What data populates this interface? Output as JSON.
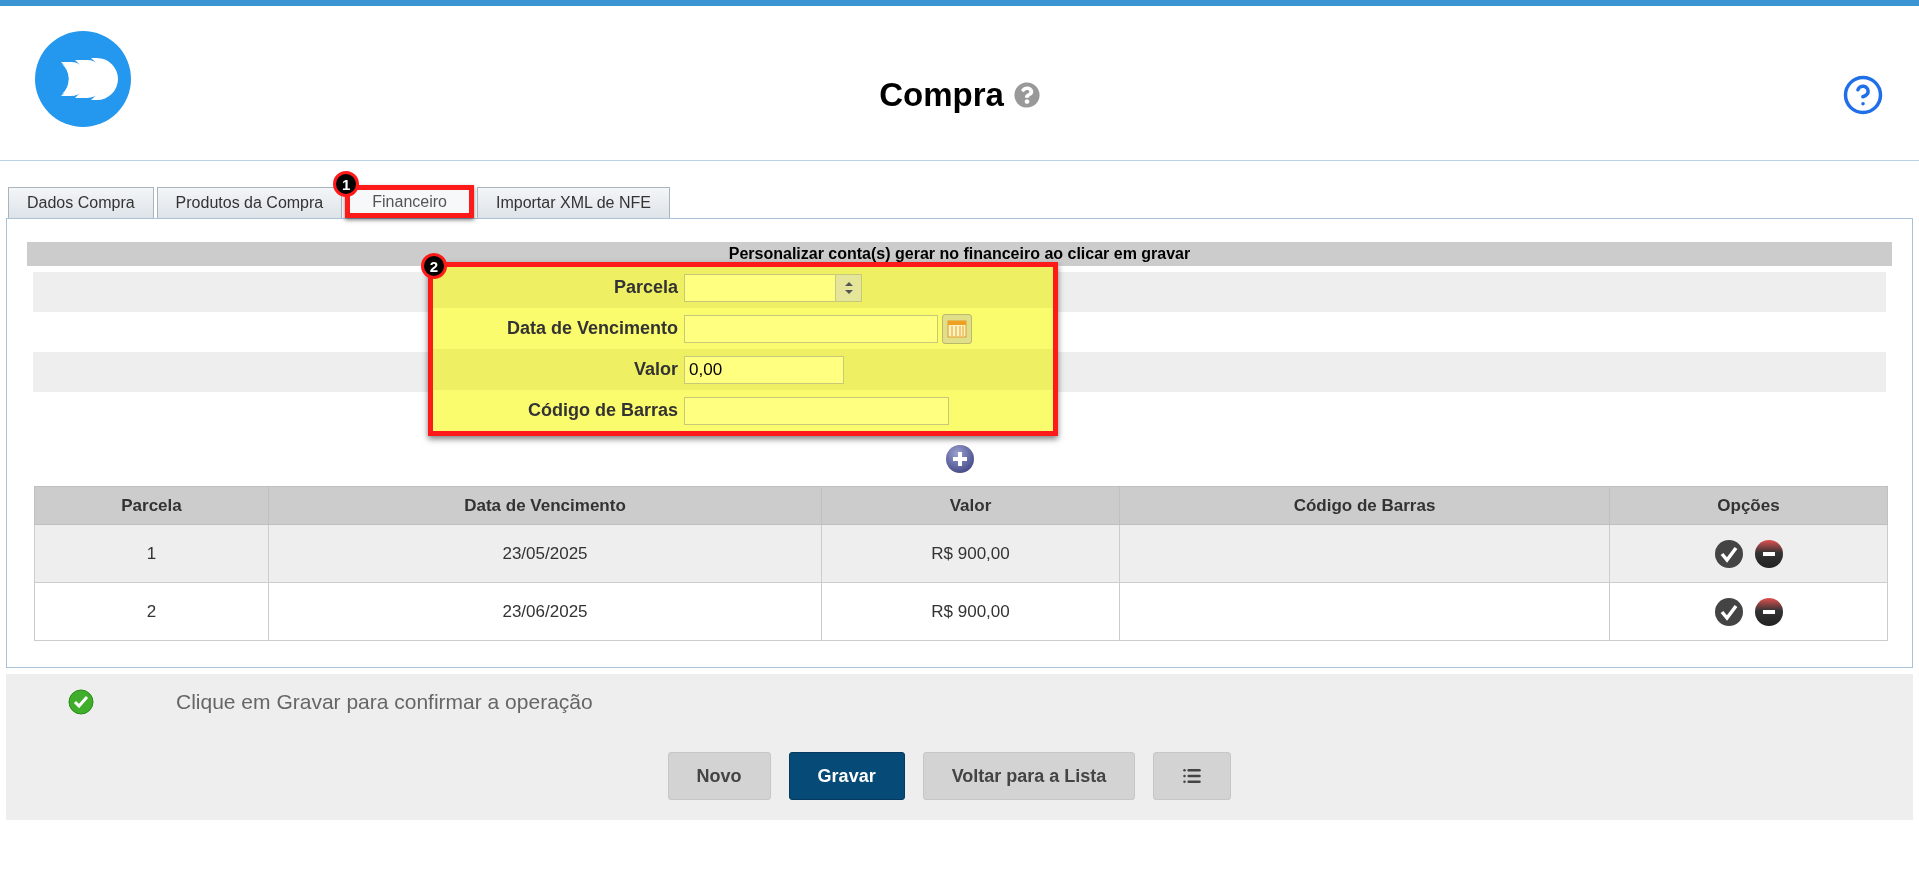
{
  "header": {
    "title": "Compra"
  },
  "tabs": [
    {
      "label": "Dados Compra",
      "selected": false
    },
    {
      "label": "Produtos da Compra",
      "selected": false
    },
    {
      "label": "Financeiro",
      "selected": true
    },
    {
      "label": "Importar XML de NFE",
      "selected": false
    }
  ],
  "annotations": [
    "1",
    "2"
  ],
  "section_title": "Personalizar conta(s) gerar no financeiro ao clicar em gravar",
  "form": {
    "fields": [
      {
        "kind": "spinner",
        "label": "Parcela"
      },
      {
        "kind": "date",
        "label": "Data de Vencimento"
      },
      {
        "kind": "text",
        "label": "Valor",
        "value": "0,00"
      },
      {
        "kind": "wide",
        "label": "Código de Barras"
      }
    ]
  },
  "table": {
    "columns": [
      "Parcela",
      "Data de Vencimento",
      "Valor",
      "Código de Barras",
      "Opções"
    ],
    "rows": [
      {
        "parcela": "1",
        "data_vencimento": "23/05/2025",
        "valor": "R$ 900,00"
      },
      {
        "parcela": "2",
        "data_vencimento": "23/06/2025",
        "valor": "R$ 900,00"
      }
    ]
  },
  "message": "Clique em Gravar para confirmar a operação",
  "buttons": [
    {
      "kind": "secondary",
      "label": "Novo"
    },
    {
      "kind": "primary",
      "label": "Gravar"
    },
    {
      "kind": "secondary",
      "label": "Voltar para a Lista"
    },
    {
      "kind": "list"
    }
  ]
}
